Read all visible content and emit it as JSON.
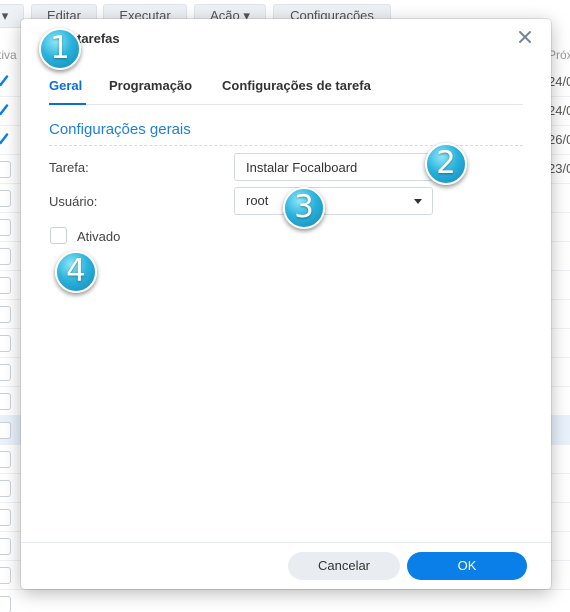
{
  "background": {
    "toolbar": [
      {
        "label": "▾"
      },
      {
        "label": "Editar"
      },
      {
        "label": "Executar"
      },
      {
        "label": "Ação ▾"
      },
      {
        "label": "Configurações"
      }
    ],
    "col_left": "tiva",
    "col_right": "Próx",
    "rows": [
      {
        "checked": true,
        "date": "24/0"
      },
      {
        "checked": true,
        "date": "24/0"
      },
      {
        "checked": true,
        "date": "26/0"
      },
      {
        "checked": false,
        "date": "23/0"
      },
      {
        "checked": false,
        "date": ""
      },
      {
        "checked": false,
        "date": ""
      },
      {
        "checked": false,
        "date": ""
      },
      {
        "checked": false,
        "date": ""
      },
      {
        "checked": false,
        "date": ""
      },
      {
        "checked": false,
        "date": ""
      },
      {
        "checked": false,
        "date": ""
      },
      {
        "checked": false,
        "date": ""
      },
      {
        "checked": false,
        "date": ""
      },
      {
        "checked": false,
        "date": ""
      },
      {
        "checked": false,
        "date": ""
      },
      {
        "checked": false,
        "date": ""
      },
      {
        "checked": false,
        "date": ""
      },
      {
        "checked": false,
        "date": ""
      },
      {
        "checked": false,
        "date": ""
      }
    ],
    "selected_row": 12
  },
  "dialog": {
    "title": "tarefas",
    "close_icon": "close-icon",
    "tabs": [
      "Geral",
      "Programação",
      "Configurações de tarefa"
    ],
    "active_tab": 0,
    "section_title": "Configurações gerais",
    "task_label": "Tarefa:",
    "task_value": "Instalar Focalboard",
    "user_label": "Usuário:",
    "user_value": "root",
    "enabled_label": "Ativado",
    "enabled_checked": false,
    "cancel_label": "Cancelar",
    "ok_label": "OK"
  },
  "badges": [
    "1",
    "2",
    "3",
    "4"
  ],
  "colors": {
    "accent": "#0a7fe8",
    "tab_active": "#0a6fd3",
    "section_title": "#1f7fd8",
    "badge": "#2bb3dd"
  }
}
